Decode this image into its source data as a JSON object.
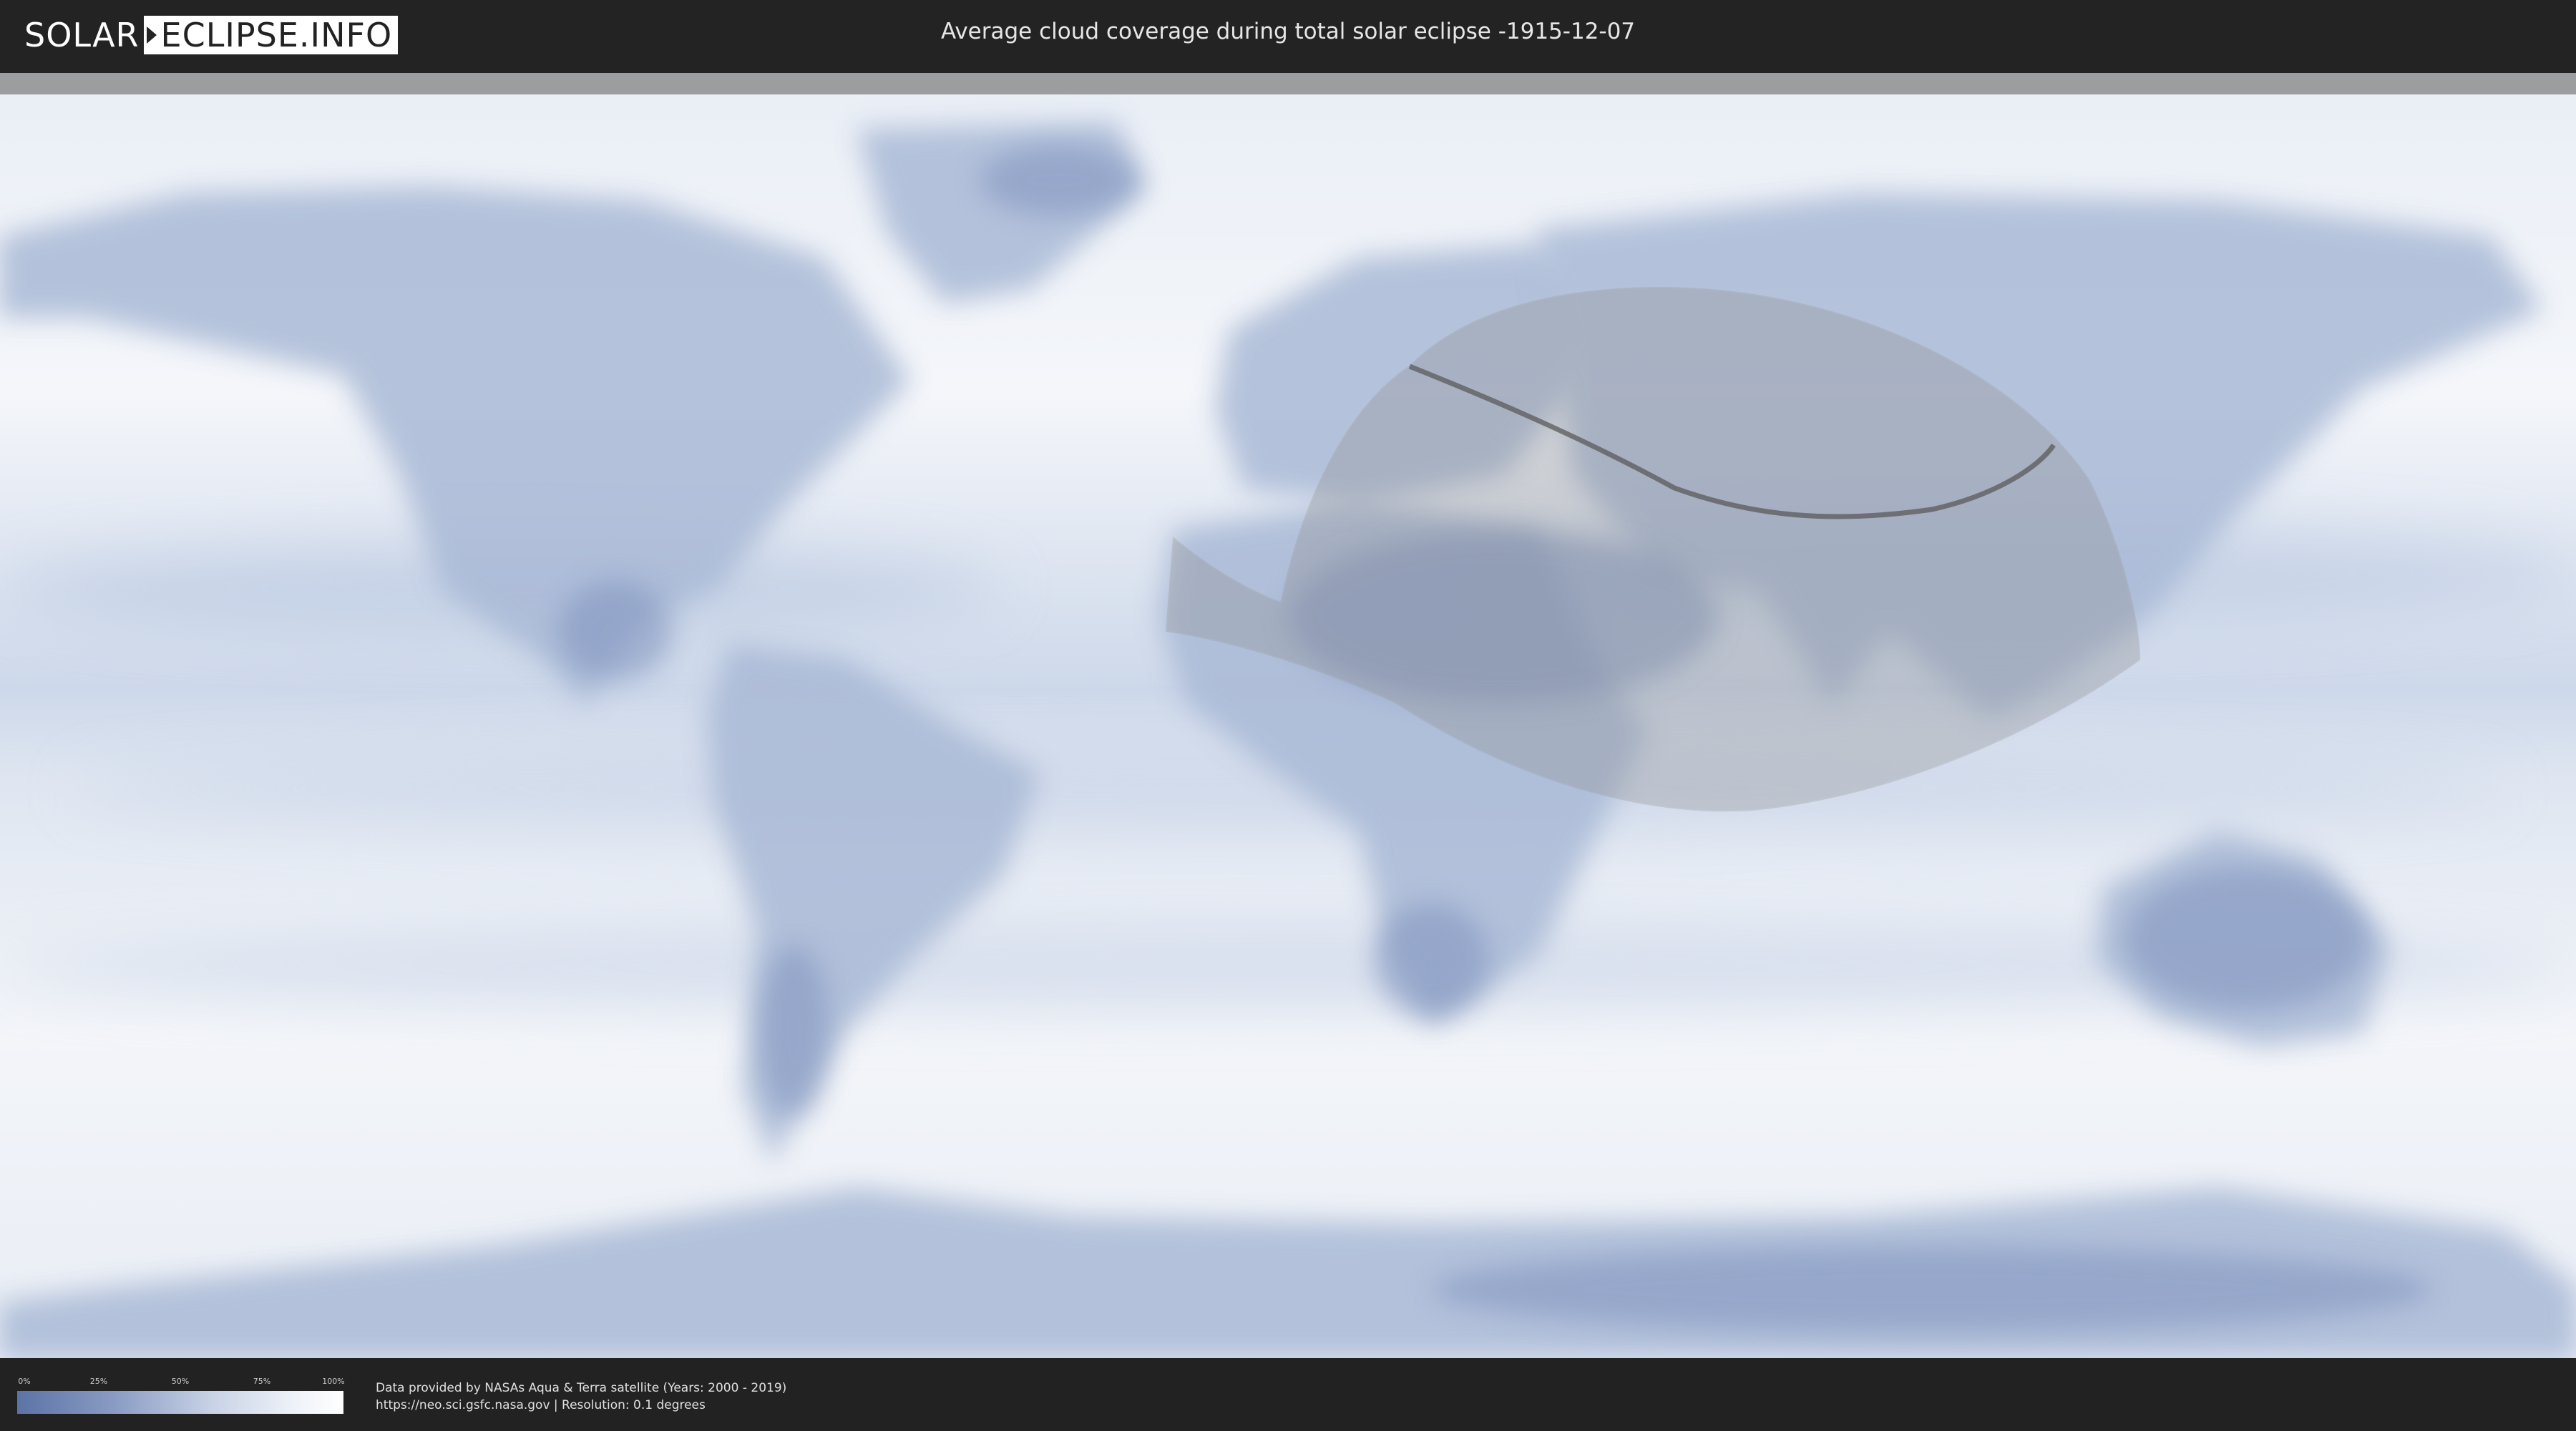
{
  "header": {
    "logo_left": "SOLAR",
    "logo_right": "ECLIPSE.INFO",
    "title": "Average cloud coverage during total solar eclipse -1915-12-07"
  },
  "legend": {
    "ticks": [
      "0%",
      "25%",
      "50%",
      "75%",
      "100%"
    ],
    "gradient_colors": [
      "#5c73a6",
      "#8a9cc4",
      "#c9d3e6",
      "#eef2f8",
      "#ffffff"
    ]
  },
  "credits": {
    "line1": "Data provided by NASAs Aqua & Terra satellite (Years: 2000 - 2019)",
    "line2": "https://neo.sci.gsfc.nasa.gov | Resolution: 0.1 degrees"
  },
  "map": {
    "projection": "equirectangular",
    "ocean_color": "#eef2f8",
    "land_tint_color": "#a9b9d6",
    "eclipse_zone_color": "#8e8e8e",
    "eclipse_path_color": "#5a5a5a"
  }
}
